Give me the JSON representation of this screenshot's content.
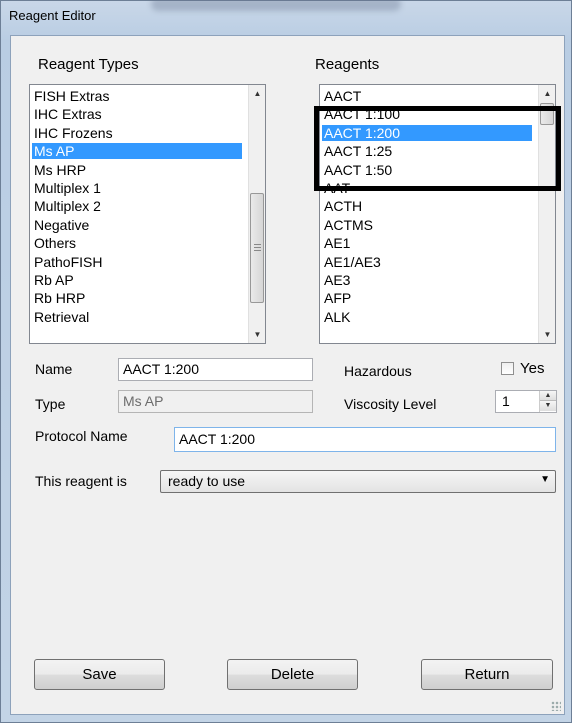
{
  "window": {
    "title": "Reagent Editor"
  },
  "reagent_types": {
    "label": "Reagent Types",
    "items": [
      "FISH Extras",
      "IHC Extras",
      "IHC Frozens",
      "Ms AP",
      "Ms HRP",
      "Multiplex 1",
      "Multiplex 2",
      "Negative",
      "Others",
      "PathoFISH",
      "Rb AP",
      "Rb HRP",
      "Retrieval"
    ],
    "selected": "Ms AP"
  },
  "reagents": {
    "label": "Reagents",
    "items": [
      "AACT",
      "AACT 1:100",
      "AACT 1:200",
      "AACT 1:25",
      "AACT 1:50",
      "AAT",
      "ACTH",
      "ACTMS",
      "AE1",
      "AE1/AE3",
      "AE3",
      "AFP",
      "ALK"
    ],
    "selected": "AACT 1:200"
  },
  "form": {
    "name_label": "Name",
    "name_value": "AACT 1:200",
    "type_label": "Type",
    "type_value": "Ms AP",
    "hazardous_label": "Hazardous",
    "hazardous_option": "Yes",
    "hazardous_checked": false,
    "viscosity_label": "Viscosity Level",
    "viscosity_value": "1",
    "protocol_label": "Protocol Name",
    "protocol_value": "AACT 1:200",
    "reagent_is_label": "This reagent is",
    "reagent_is_value": "ready to use"
  },
  "buttons": {
    "save": "Save",
    "delete": "Delete",
    "return": "Return"
  },
  "colors": {
    "selection": "#3399ff",
    "annotation_box": "#000000"
  }
}
